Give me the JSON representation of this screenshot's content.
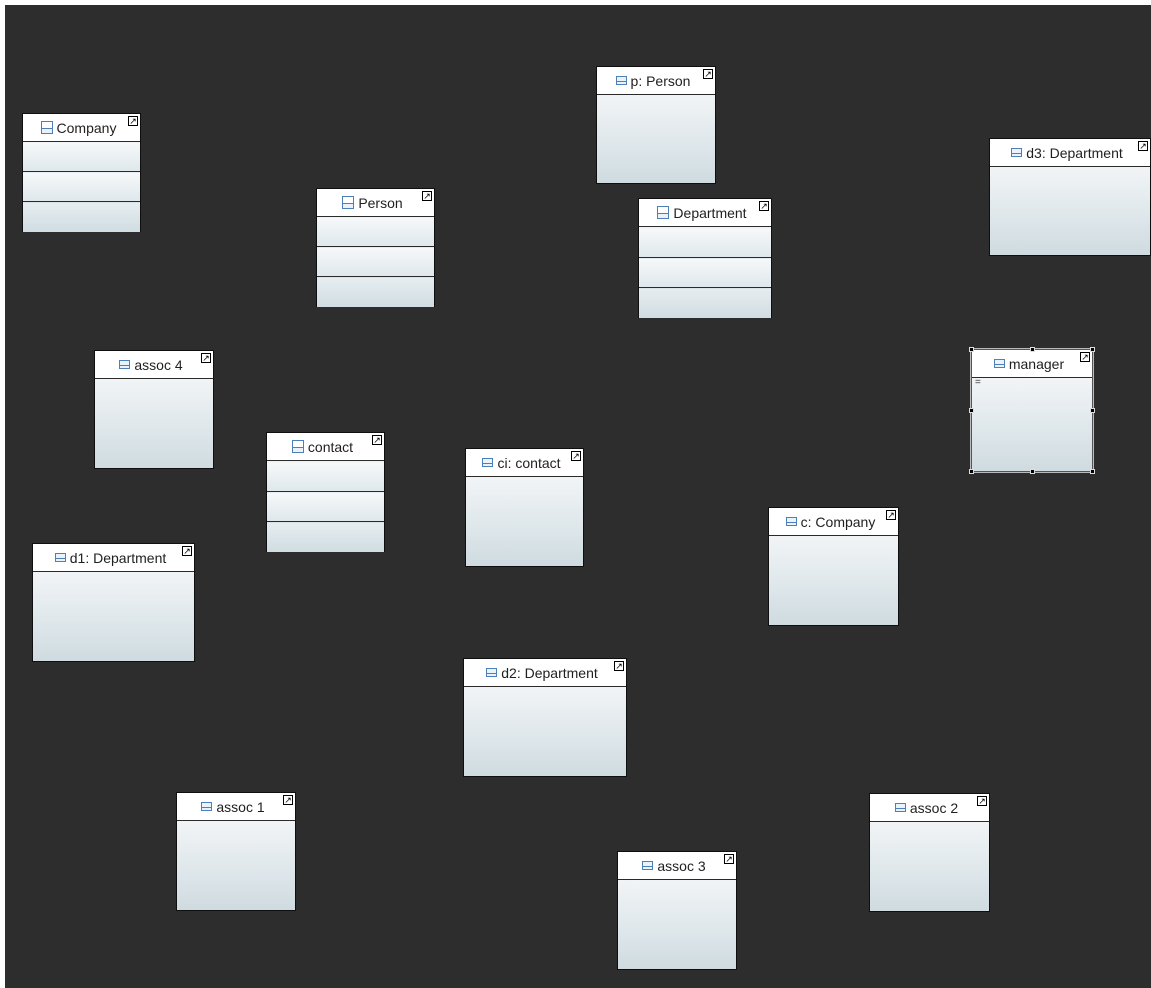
{
  "nodes": {
    "company_class": "Company",
    "person_class": "Person",
    "department_class": "Department",
    "contact_class": "contact",
    "p_person": "p: Person",
    "d3_department": "d3: Department",
    "assoc4": "assoc 4",
    "manager": "manager",
    "ci_contact": "ci: contact",
    "c_company": "c: Company",
    "d1_department": "d1: Department",
    "d2_department": "d2: Department",
    "assoc1": "assoc 1",
    "assoc2": "assoc 2",
    "assoc3": "assoc 3"
  },
  "icons": {
    "class": "class-icon",
    "object": "object-icon",
    "collapse": "collapse-arrow-icon"
  },
  "selected_node": "manager",
  "colors": {
    "canvas": "#2d2d2d",
    "node_fill": "#dde6ea",
    "icon_blue": "#4d7fb8"
  }
}
